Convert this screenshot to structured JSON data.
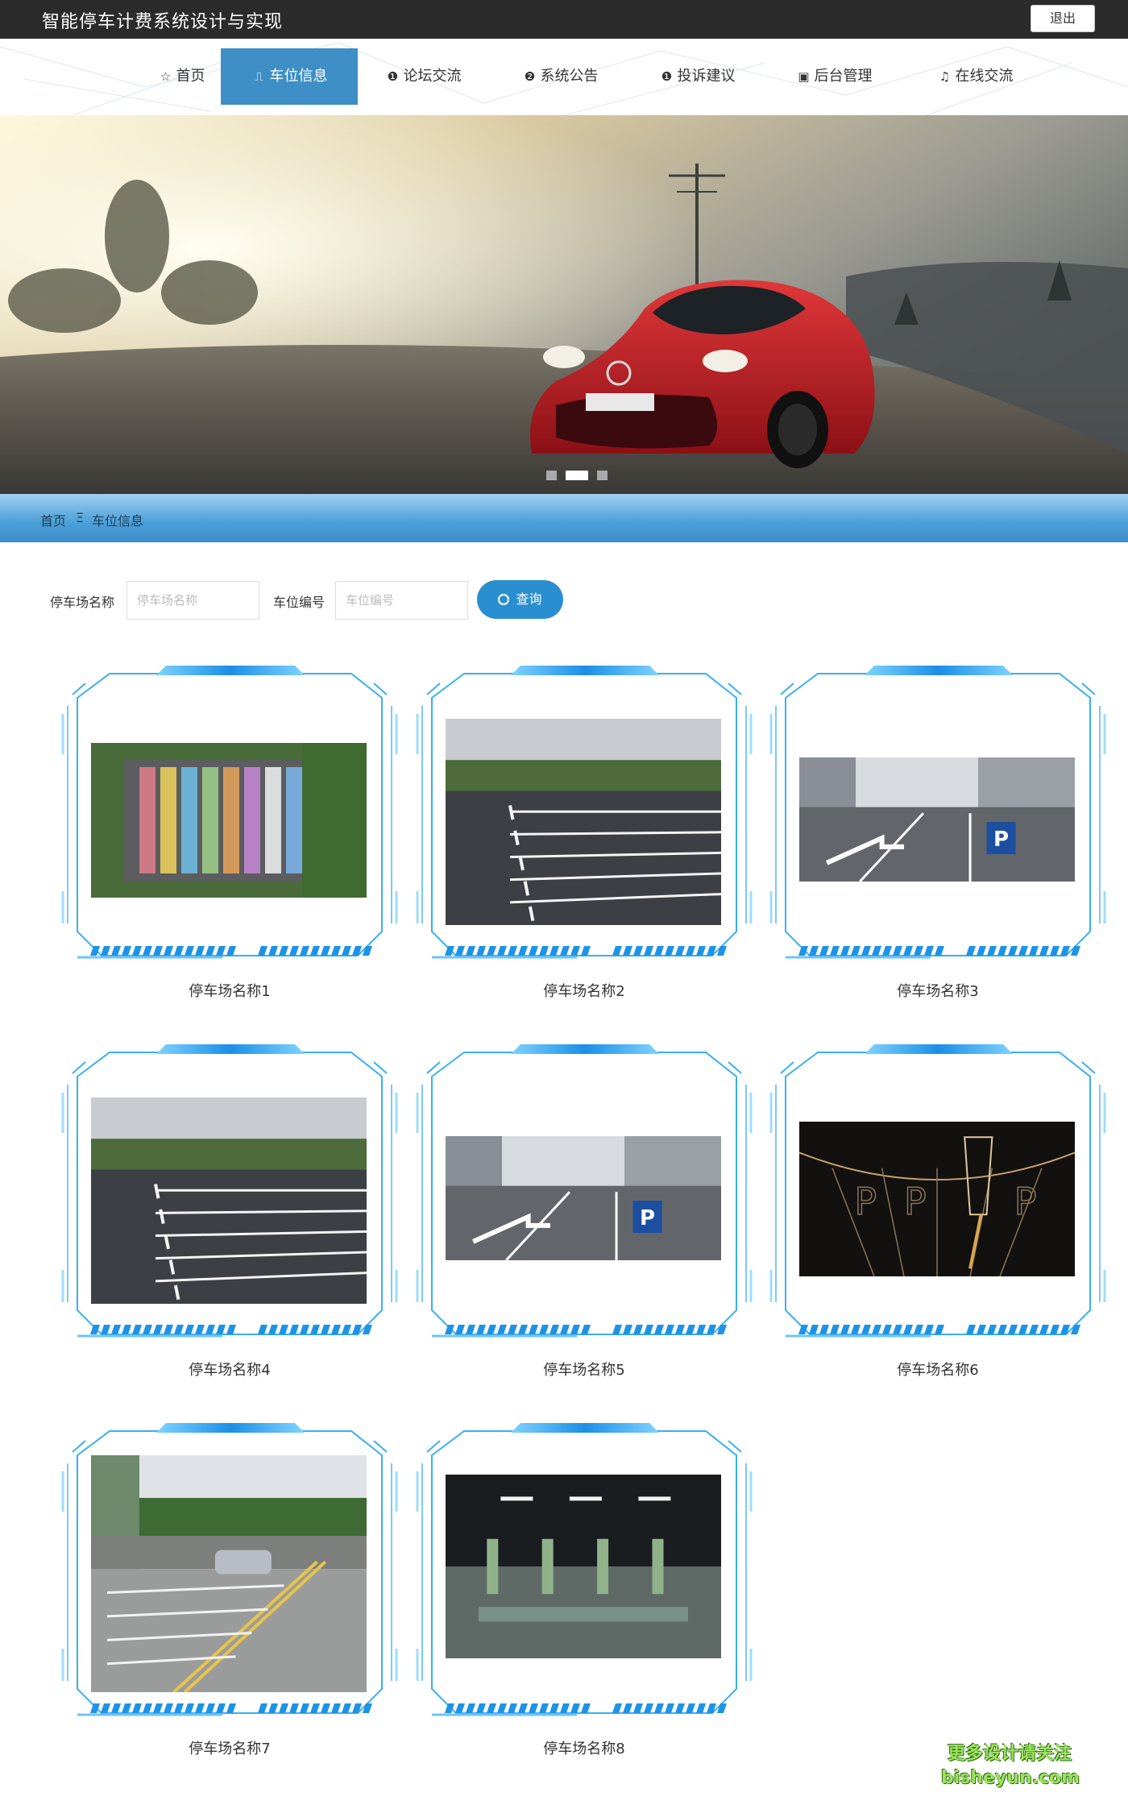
{
  "header": {
    "title": "智能停车计费系统设计与实现",
    "logout_label": "退出"
  },
  "nav": [
    {
      "label": "首页",
      "icon": "star-icon"
    },
    {
      "label": "车位信息",
      "icon": "bag-icon",
      "active": true
    },
    {
      "label": "论坛交流",
      "icon": "info-circle-icon"
    },
    {
      "label": "系统公告",
      "icon": "question-circle-icon"
    },
    {
      "label": "投诉建议",
      "icon": "info-circle-icon"
    },
    {
      "label": "后台管理",
      "icon": "box-icon"
    },
    {
      "label": "在线交流",
      "icon": "headset-icon"
    }
  ],
  "banner": {
    "slide_count": 3,
    "active_slide": 2
  },
  "breadcrumb": {
    "home": "首页",
    "separator": "Ξ",
    "current": "车位信息"
  },
  "search": {
    "lot_name_label": "停车场名称",
    "lot_name_placeholder": "停车场名称",
    "space_no_label": "车位编号",
    "space_no_placeholder": "车位编号",
    "button_label": "查询"
  },
  "lots": [
    {
      "name": "停车场名称1",
      "photo": "colorful-lot"
    },
    {
      "name": "停车场名称2",
      "photo": "asphalt-lot"
    },
    {
      "name": "停车场名称3",
      "photo": "street-parking"
    },
    {
      "name": "停车场名称4",
      "photo": "asphalt-lot"
    },
    {
      "name": "停车场名称5",
      "photo": "street-parking"
    },
    {
      "name": "停车场名称6",
      "photo": "dark-parking"
    },
    {
      "name": "停车场名称7",
      "photo": "outdoor-lot"
    },
    {
      "name": "停车场名称8",
      "photo": "underground-garage"
    }
  ],
  "watermark": {
    "line1": "更多设计请关注",
    "line2": "bisheyun.com"
  },
  "colors": {
    "topbar": "#2b2b2b",
    "accent": "#3d8fc6",
    "frame": "#2aa8f0",
    "button": "#2a8fd0"
  }
}
